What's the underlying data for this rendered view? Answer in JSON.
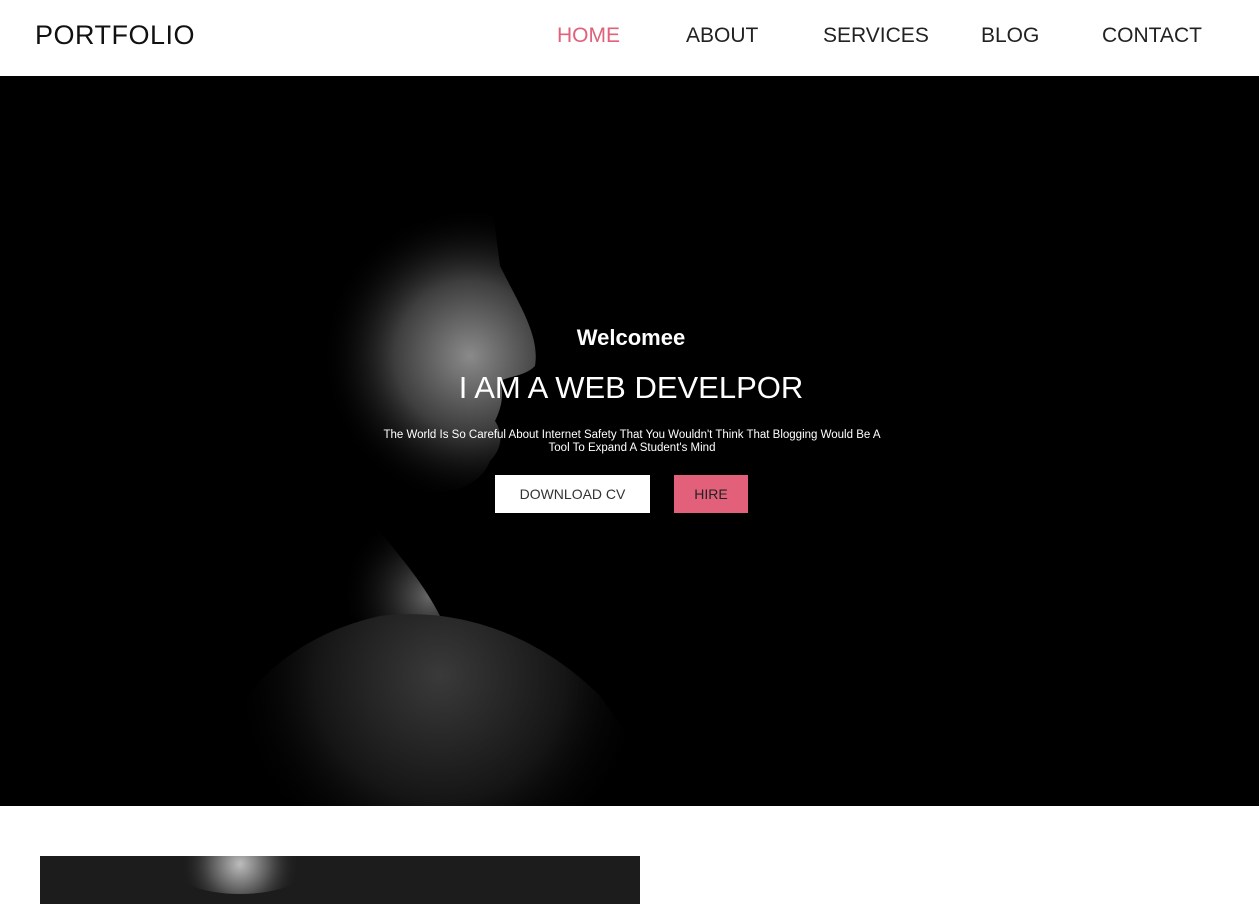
{
  "brand": "PORTFOLIO",
  "nav": {
    "items": [
      "HOME",
      "ABOUT",
      "SERVICES",
      "BLOG",
      "CONTACT"
    ],
    "active": "HOME",
    "active_color": "#e2607a"
  },
  "hero": {
    "welcome": "Welcomee",
    "headline": "I AM A WEB DEVELPOR",
    "tagline": "The World Is So Careful About Internet Safety That You Wouldn't Think That Blogging Would Be A Tool To Expand A Student's Mind",
    "download_cv": "DOWNLOAD CV",
    "hire": "HIRE",
    "background_color": "#000000"
  }
}
